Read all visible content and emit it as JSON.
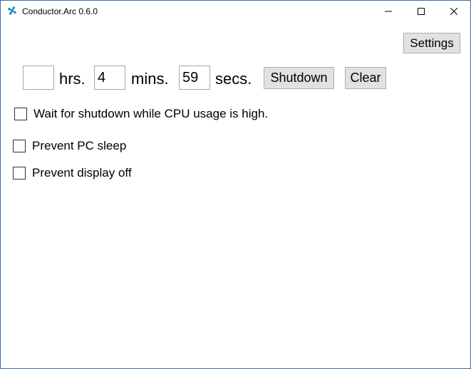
{
  "window": {
    "title": "Conductor.Arc 0.6.0",
    "app_icon": "pinwheel-icon",
    "accent_color": "#1e90c8"
  },
  "toolbar": {
    "settings_label": "Settings"
  },
  "timer": {
    "hours_value": "",
    "hours_unit": "hrs.",
    "minutes_value": "4",
    "minutes_unit": "mins.",
    "seconds_value": "59",
    "seconds_unit": "secs.",
    "shutdown_label": "Shutdown",
    "clear_label": "Clear"
  },
  "options": [
    {
      "label": "Wait for shutdown while CPU usage is high.",
      "checked": false
    },
    {
      "label": "Prevent PC sleep",
      "checked": false
    },
    {
      "label": "Prevent display off",
      "checked": false
    }
  ],
  "caption_buttons": {
    "minimize_icon": "minimize-icon",
    "maximize_icon": "maximize-icon",
    "close_icon": "close-icon"
  }
}
